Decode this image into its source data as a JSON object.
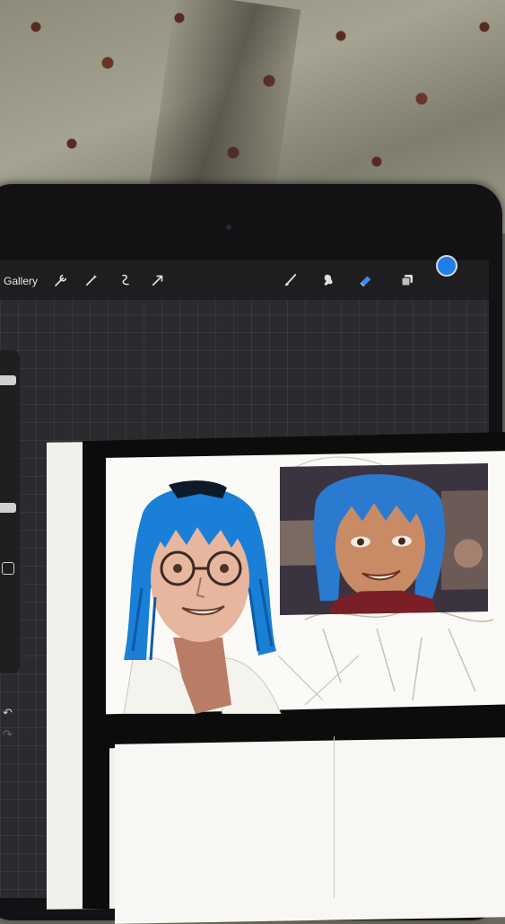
{
  "toolbar": {
    "gallery_label": "Gallery",
    "left_tools": [
      "wrench-icon",
      "magic-wand-icon",
      "selection-icon",
      "transform-arrow-icon"
    ],
    "right_tools": [
      "brush-icon",
      "smudge-icon",
      "eraser-icon",
      "layers-icon"
    ],
    "active_tool": "eraser-icon",
    "current_color": "#1f7ee8"
  },
  "sidebar": {
    "controls": [
      "brush-size-slider",
      "modify-button",
      "opacity-slider",
      "undo-icon",
      "redo-icon"
    ]
  },
  "canvas": {
    "background_grid": true,
    "drawing_colors": {
      "hair": "#1a7fd6",
      "skin": "#e6b79e",
      "panel_border": "#0c0c0c"
    }
  }
}
